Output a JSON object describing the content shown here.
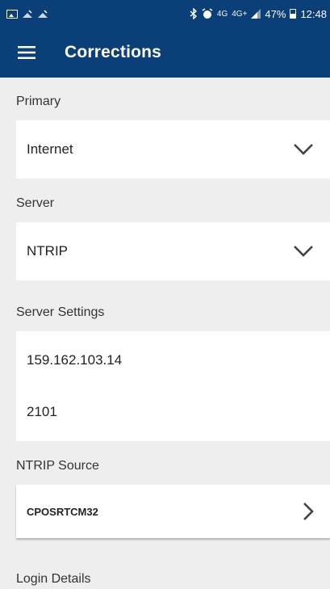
{
  "status_bar": {
    "network_type_1": "4G",
    "network_type_2": "4G+",
    "battery": "47%",
    "time": "12:48"
  },
  "header": {
    "title": "Corrections"
  },
  "sections": {
    "primary": {
      "label": "Primary",
      "value": "Internet"
    },
    "server": {
      "label": "Server",
      "value": "NTRIP"
    },
    "server_settings": {
      "label": "Server Settings",
      "address": "159.162.103.14",
      "port": "2101"
    },
    "ntrip_source": {
      "label": "NTRIP Source",
      "value": "CPOSRTCM32"
    },
    "login_details": {
      "label": "Login Details"
    }
  },
  "icons": {
    "menu": "hamburger-icon",
    "dropdown": "chevron-down-icon",
    "navigate": "chevron-right-icon"
  },
  "colors": {
    "app_bar": "#0b3f78",
    "background": "#eeeeee",
    "card": "#ffffff"
  }
}
